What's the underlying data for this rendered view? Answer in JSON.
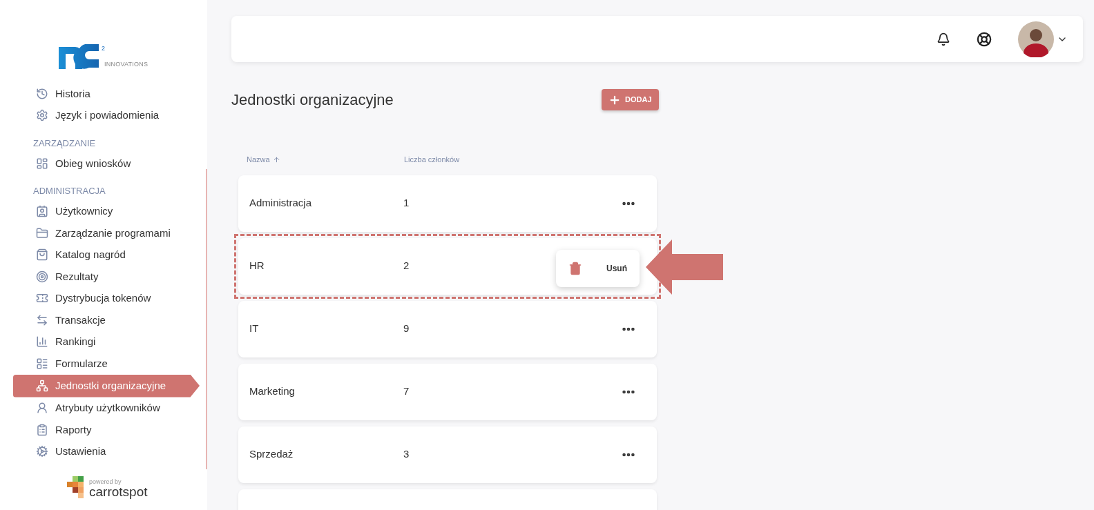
{
  "logo": {
    "superscript": "2",
    "tagline": "INNOVATIONS"
  },
  "sidebar": {
    "sections": [
      {
        "items": [
          {
            "label": "Historia",
            "selected": false
          },
          {
            "label": "Język i powiadomienia",
            "selected": false
          }
        ]
      },
      {
        "heading": "ZARZĄDZANIE",
        "items": [
          {
            "label": "Obieg wniosków",
            "selected": false
          }
        ]
      },
      {
        "heading": "ADMINISTRACJA",
        "items": [
          {
            "label": "Użytkownicy",
            "selected": false
          },
          {
            "label": "Zarządzanie programami",
            "selected": false
          },
          {
            "label": "Katalog nagród",
            "selected": false
          },
          {
            "label": "Rezultaty",
            "selected": false
          },
          {
            "label": "Dystrybucja tokenów",
            "selected": false
          },
          {
            "label": "Transakcje",
            "selected": false
          },
          {
            "label": "Rankingi",
            "selected": false
          },
          {
            "label": "Formularze",
            "selected": false
          },
          {
            "label": "Jednostki organizacyjne",
            "selected": true
          },
          {
            "label": "Atrybuty użytkowników",
            "selected": false
          },
          {
            "label": "Raporty",
            "selected": false
          },
          {
            "label": "Ustawienia",
            "selected": false
          }
        ]
      }
    ]
  },
  "footer": {
    "powered_by": "powered by",
    "brand": "carrotspot"
  },
  "page": {
    "title": "Jednostki organizacyjne",
    "add_button": "DODAJ"
  },
  "table": {
    "columns": [
      {
        "label": "Nazwa",
        "sorted": true
      },
      {
        "label": "Liczba członków",
        "sorted": false
      }
    ],
    "rows": [
      {
        "name": "Administracja",
        "count": "1",
        "menu_open": false,
        "highlighted": false
      },
      {
        "name": "HR",
        "count": "2",
        "menu_open": true,
        "highlighted": true
      },
      {
        "name": "IT",
        "count": "9",
        "menu_open": false,
        "highlighted": false
      },
      {
        "name": "Marketing",
        "count": "7",
        "menu_open": false,
        "highlighted": false
      },
      {
        "name": "Sprzedaż",
        "count": "3",
        "menu_open": false,
        "highlighted": false
      }
    ],
    "row_menu": {
      "items": [
        {
          "label": "Usuń"
        }
      ]
    }
  }
}
